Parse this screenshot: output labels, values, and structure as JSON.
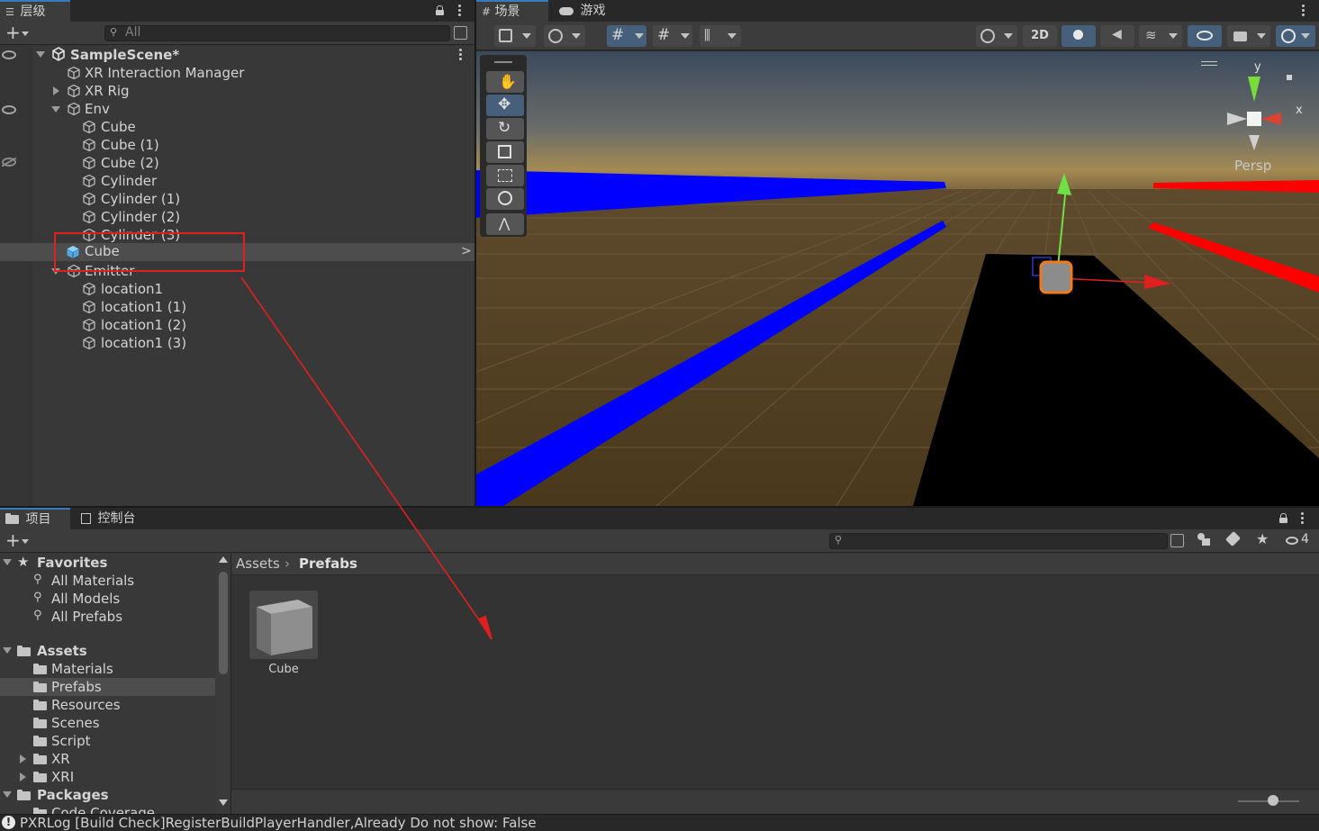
{
  "hierarchy": {
    "tab_label": "层级",
    "search_placeholder": "All",
    "scene_name": "SampleScene*",
    "items": [
      {
        "label": "XR Interaction Manager"
      },
      {
        "label": "XR Rig"
      },
      {
        "label": "Env"
      },
      {
        "label": "Cube"
      },
      {
        "label": "Cube (1)"
      },
      {
        "label": "Cube (2)"
      },
      {
        "label": "Cylinder"
      },
      {
        "label": "Cylinder (1)"
      },
      {
        "label": "Cylinder (2)"
      },
      {
        "label": "Cylinder (3)"
      },
      {
        "label": "Cube"
      },
      {
        "label": "Emitter"
      },
      {
        "label": "location1"
      },
      {
        "label": "location1 (1)"
      },
      {
        "label": "location1 (2)"
      },
      {
        "label": "location1 (3)"
      }
    ]
  },
  "scene": {
    "tab_scene": "场景",
    "tab_game": "游戏",
    "btn_2d": "2D",
    "gizmo_y": "y",
    "gizmo_x": "x",
    "persp_label": "Persp"
  },
  "project": {
    "tab_project": "项目",
    "tab_console": "控制台",
    "hidden_count": "4",
    "favorites_label": "Favorites",
    "favorites": [
      "All Materials",
      "All Models",
      "All Prefabs"
    ],
    "assets_label": "Assets",
    "assets": [
      "Materials",
      "Prefabs",
      "Resources",
      "Scenes",
      "Script",
      "XR",
      "XRI"
    ],
    "packages_label": "Packages",
    "packages_partial": "Code Coverage",
    "breadcrumb": [
      "Assets",
      "Prefabs"
    ],
    "grid_items": [
      {
        "label": "Cube"
      }
    ]
  },
  "status_bar": {
    "message": "PXRLog [Build Check]RegisterBuildPlayerHandler,Already Do not show: False"
  },
  "colors": {
    "accent_blue": "#3a79bb",
    "annotation_red": "#e02020",
    "selected_row": "#4d4d4d"
  }
}
